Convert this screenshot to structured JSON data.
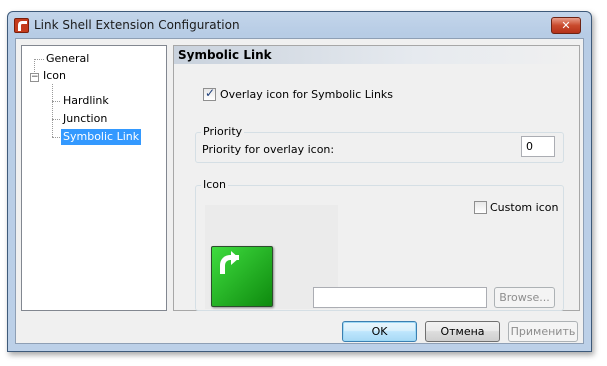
{
  "window": {
    "title": "Link Shell Extension Configuration",
    "close_label": "✕"
  },
  "tree": {
    "items": [
      {
        "label": "General"
      },
      {
        "label": "Icon",
        "expander": "−"
      },
      {
        "label": "Hardlink"
      },
      {
        "label": "Junction"
      },
      {
        "label": "Symbolic Link",
        "selected": true
      }
    ]
  },
  "content": {
    "header": "Symbolic Link",
    "overlay_checkbox": {
      "label": "Overlay icon for Symbolic Links",
      "checked": true
    },
    "priority_group": {
      "title": "Priority",
      "label": "Priority for overlay icon:",
      "value": "0"
    },
    "icon_group": {
      "title": "Icon",
      "custom_icon": {
        "label": "Custom icon",
        "checked": false
      },
      "path_value": "",
      "browse_label": "Browse..."
    }
  },
  "buttons": {
    "ok": "OK",
    "cancel": "Отмена",
    "apply": "Применить"
  },
  "colors": {
    "selection": "#3399ff",
    "titlebar": "#bcd0e8",
    "close_button": "#c94a2c"
  }
}
